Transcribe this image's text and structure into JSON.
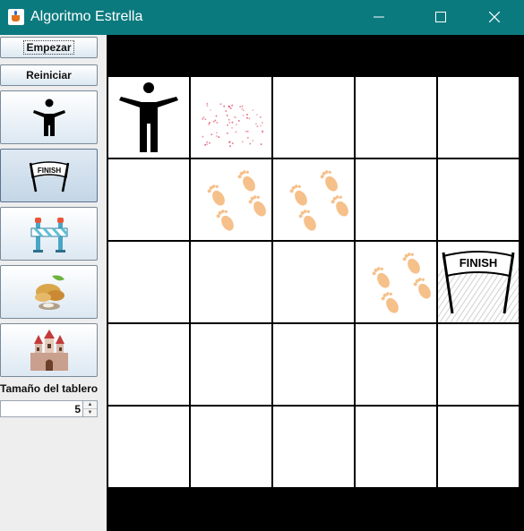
{
  "window": {
    "title": "Algoritmo Estrella"
  },
  "sidebar": {
    "start_label": "Empezar",
    "reset_label": "Reiniciar",
    "tools": [
      {
        "name": "person-icon",
        "selected": false
      },
      {
        "name": "finish-icon",
        "selected": true
      },
      {
        "name": "barrier-icon",
        "selected": false
      },
      {
        "name": "food-icon",
        "selected": false
      },
      {
        "name": "castle-icon",
        "selected": false
      }
    ],
    "size_label": "Tamaño del tablero",
    "size_value": "5"
  },
  "board": {
    "size": 5,
    "cells": [
      [
        "person",
        "explored",
        "",
        "",
        ""
      ],
      [
        "",
        "footprints",
        "footprints",
        "",
        ""
      ],
      [
        "",
        "",
        "",
        "footprints",
        "finish"
      ],
      [
        "",
        "",
        "",
        "",
        ""
      ],
      [
        "",
        "",
        "",
        "",
        ""
      ]
    ],
    "finish_text": "FINISH"
  },
  "colors": {
    "titlebar": "#0b7a7e",
    "footprints": "#f6c08a",
    "explored": "#e0556d",
    "board_background": "#000000"
  }
}
